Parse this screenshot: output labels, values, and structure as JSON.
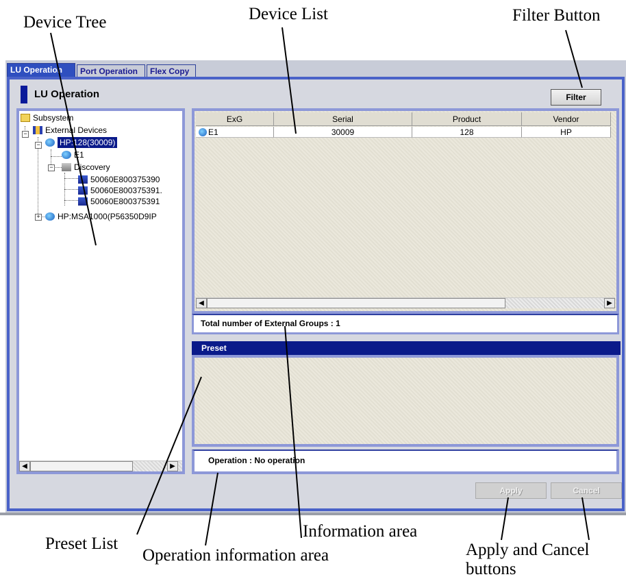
{
  "callouts": {
    "device_tree": "Device Tree",
    "device_list": "Device List",
    "filter_button": "Filter Button",
    "preset_list": "Preset List",
    "operation_info": "Operation information area",
    "information_area": "Information area",
    "apply_cancel_line1": "Apply and Cancel",
    "apply_cancel_line2": "buttons"
  },
  "tabs": [
    "LU Operation",
    "Port Operation",
    "Flex Copy"
  ],
  "page_title": "LU Operation",
  "filter_label": "Filter",
  "tree": {
    "items": [
      {
        "label": "Subsystem",
        "icon": "folder-icon"
      },
      {
        "label": "External Devices",
        "icon": "storage-icon"
      },
      {
        "label": "HP:128(30009)",
        "icon": "globe-icon",
        "selected": true
      },
      {
        "label": "E1",
        "icon": "globe-icon"
      },
      {
        "label": "Discovery",
        "icon": "discovery-icon"
      },
      {
        "label": "50060E800375390",
        "icon": "port-icon"
      },
      {
        "label": "50060E800375391.",
        "icon": "port-icon"
      },
      {
        "label": "50060E800375391",
        "icon": "port-icon"
      },
      {
        "label": "HP:MSA1000(P56350D9IP",
        "icon": "globe-icon"
      }
    ]
  },
  "device_list": {
    "columns": [
      "ExG",
      "Serial",
      "Product",
      "Vendor"
    ],
    "rows": [
      {
        "exg": "E1",
        "serial": "30009",
        "product": "128",
        "vendor": "HP"
      }
    ]
  },
  "info_text": "Total number of External Groups : 1",
  "preset_label": "Preset",
  "operation_text": "Operation : No operation",
  "buttons": {
    "apply": "Apply",
    "cancel": "Cancel"
  },
  "colors": {
    "accent": "#0a1a8a",
    "border": "#4a62c8",
    "panel_border": "#8d98d8"
  }
}
